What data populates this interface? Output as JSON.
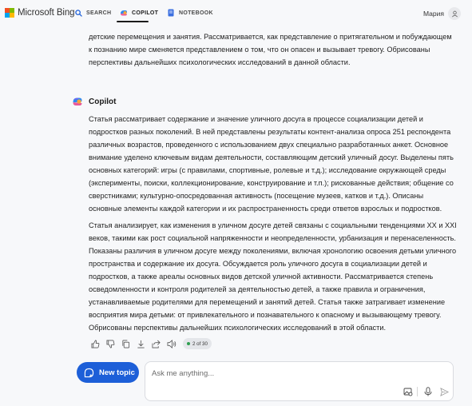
{
  "header": {
    "logo_text": "Microsoft Bing",
    "tabs": [
      {
        "label": "SEARCH",
        "icon": "search-icon"
      },
      {
        "label": "COPILOT",
        "icon": "copilot-icon",
        "active": true
      },
      {
        "label": "NOTEBOOK",
        "icon": "notebook-icon"
      }
    ],
    "user_name": "Мария"
  },
  "conversation": {
    "previous_tail": "детские перемещения и занятия. Рассматривается, как представление о притягательном и побуждающем к познанию мире сменяется представлением о том, что он опасен и вызывает тревогу. Обрисованы перспективы дальнейших психологических исследований в данной области.",
    "assistant_name": "Copilot",
    "paragraph1": "Статья рассматривает содержание и значение уличного досуга в процессе социализации детей и подростков разных поколений. В ней представлены результаты контент-анализа опроса 251 респондента различных возрастов, проведенного с использованием двух специально разработанных анкет. Основное внимание уделено ключевым видам деятельности, составляющим детский уличный досуг. Выделены пять основных категорий: игры (с правилами, спортивные, ролевые и т.д.); исследование окружающей среды (эксперименты, поиски, коллекционирование, конструирование и т.п.); рискованные действия; общение со сверстниками; культурно-опосредованная активность (посещение музеев, катков и т.д.). Описаны основные элементы каждой категории и их распространенность среди ответов взрослых и подростков.",
    "paragraph2": "Статья анализирует, как изменения в уличном досуге детей связаны с социальными тенденциями XX и XXI веков, такими как рост социальной напряженности и неопределенности, урбанизация и перенаселенность. Показаны различия в уличном досуге между поколениями, включая хронологию освоения детьми уличного пространства и содержание их досуга. Обсуждается роль уличного досуга в социализации детей и подростков, а также ареалы основных видов детской уличной активности. Рассматривается степень осведомленности и контроля родителей за деятельностью детей, а также правила и ограничения, устанавливаемые родителями для перемещений и занятий детей. Статья также затрагивает изменение восприятия мира детьми: от привлекательного и познавательного к опасному и вызывающему тревогу. Обрисованы перспективы дальнейших психологических исследований в этой области.",
    "response_counter": "2 of 30"
  },
  "composer": {
    "new_topic_label": "New topic",
    "placeholder": "Ask me anything..."
  },
  "colors": {
    "accent": "#1d5fd8",
    "background": "#f7f8fa",
    "status_green": "#2e9e4f"
  }
}
